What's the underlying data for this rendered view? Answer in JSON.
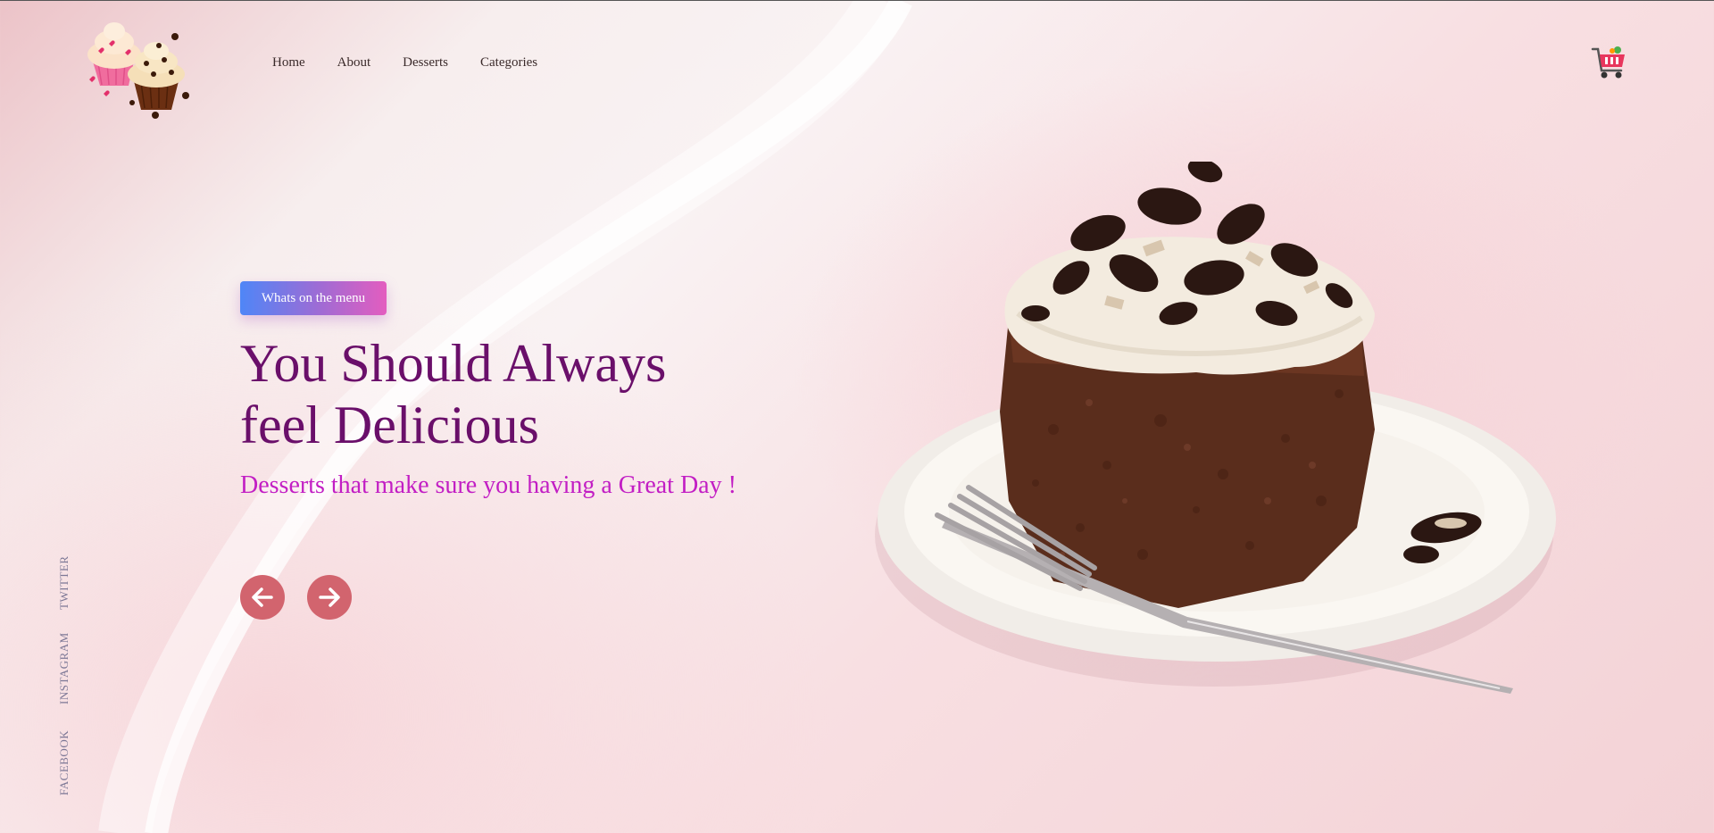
{
  "nav": {
    "items": [
      {
        "label": "Home"
      },
      {
        "label": "About"
      },
      {
        "label": "Desserts"
      },
      {
        "label": "Categories"
      }
    ]
  },
  "hero": {
    "badge": "Whats on the menu",
    "title_line1": "You Should Always",
    "title_line2": "feel Delicious",
    "subtitle": "Desserts that make sure you having a Great Day !"
  },
  "social": {
    "twitter": "TWITTER",
    "instagram": "INSTAGRAM",
    "facebook": "FACEBOOK"
  },
  "icons": {
    "logo": "cupcakes-logo",
    "cart": "shopping-cart-icon",
    "prev": "arrow-left-icon",
    "next": "arrow-right-icon"
  },
  "colors": {
    "title": "#6a0f6a",
    "subtitle": "#c21ec4",
    "arrow_bg": "#d2646e",
    "badge_start": "#4f86f7",
    "badge_end": "#e35dbf"
  }
}
